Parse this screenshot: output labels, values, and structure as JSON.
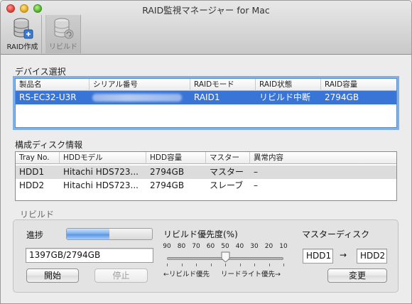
{
  "window": {
    "title": "RAID監視マネージャー for Mac"
  },
  "toolbar": {
    "create_label": "RAID作成",
    "rebuild_label": "リビルド"
  },
  "device_section": {
    "title": "デバイス選択",
    "columns": [
      "製品名",
      "シリアル番号",
      "RAIDモード",
      "RAID状態",
      "RAID容量"
    ],
    "rows": [
      {
        "product": "RS-EC32-U3R",
        "serial": "",
        "raid_mode": "RAID1",
        "raid_status": "リビルド中断",
        "capacity": "2794GB",
        "selected": true
      }
    ]
  },
  "disk_section": {
    "title": "構成ディスク情報",
    "columns": [
      "Tray No.",
      "HDDモデル",
      "HDD容量",
      "マスター",
      "異常内容"
    ],
    "rows": [
      {
        "tray": "HDD1",
        "model": "Hitachi HDS723...",
        "capacity": "2794GB",
        "role": "マスター",
        "error": "–"
      },
      {
        "tray": "HDD2",
        "model": "Hitachi HDS723...",
        "capacity": "2794GB",
        "role": "スレーブ",
        "error": "–"
      }
    ]
  },
  "rebuild": {
    "title": "リビルド",
    "progress_label": "進捗",
    "progress_fraction": 0.5,
    "progress_text": "1397GB/2794GB",
    "start_button": "開始",
    "stop_button": "停止",
    "priority_label": "リビルド優先度(%)",
    "priority_ticks": [
      "90",
      "80",
      "70",
      "60",
      "50",
      "40",
      "30",
      "20",
      "10"
    ],
    "priority_value": 50,
    "priority_left_caption": "←リビルド優先",
    "priority_right_caption": "リードライト優先→",
    "master_label": "マスターディスク",
    "master_from": "HDD1",
    "master_arrow": "→",
    "master_to": "HDD2",
    "change_button": "変更"
  }
}
